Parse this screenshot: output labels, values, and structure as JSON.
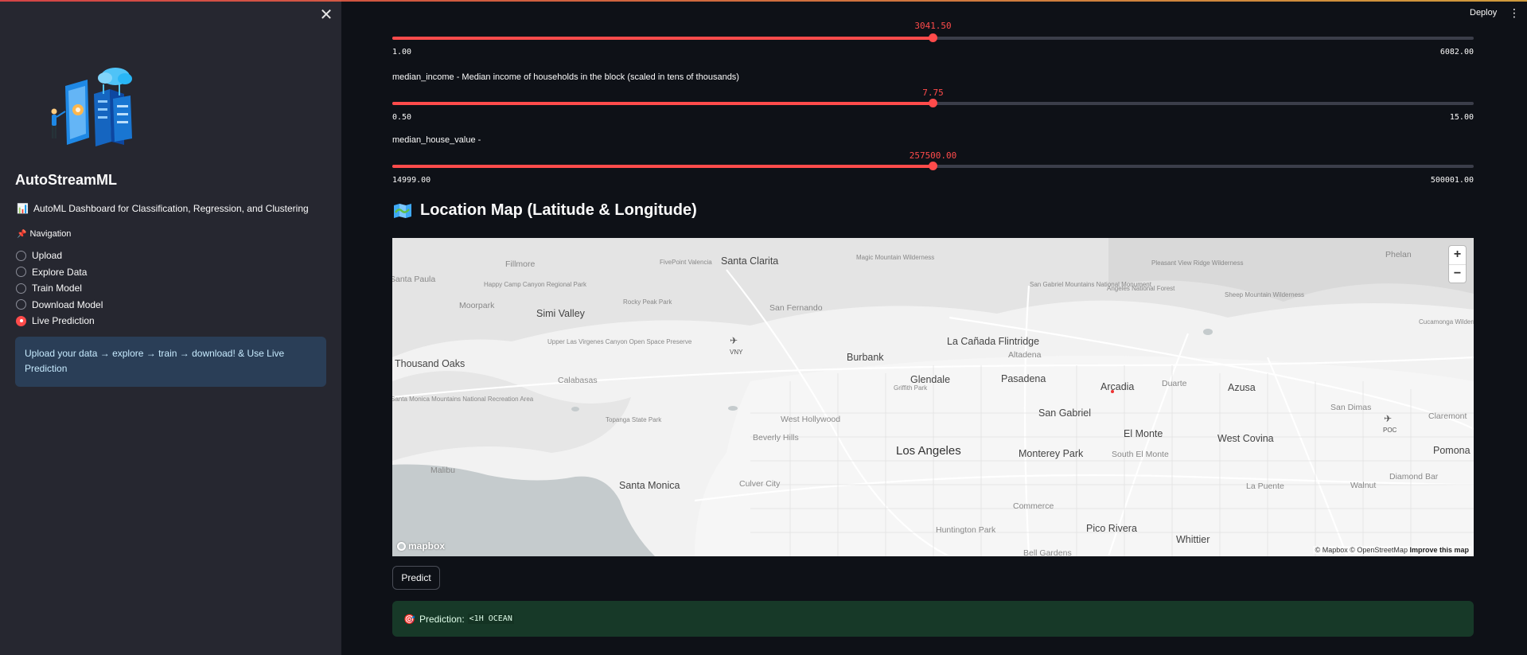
{
  "header": {
    "deploy_label": "Deploy",
    "menu_icon": "kebab-menu-icon"
  },
  "sidebar": {
    "close_icon": "close-icon",
    "title": "AutoStreamML",
    "description_icon": "bar-chart-icon",
    "description": "AutoML Dashboard for Classification, Regression, and Clustering",
    "nav_icon": "pushpin-icon",
    "nav_label": "Navigation",
    "nav_items": [
      {
        "label": "Upload",
        "selected": false
      },
      {
        "label": "Explore Data",
        "selected": false
      },
      {
        "label": "Train Model",
        "selected": false
      },
      {
        "label": "Download Model",
        "selected": false
      },
      {
        "label": "Live Prediction",
        "selected": true
      }
    ],
    "info": "Upload your data → explore → train → download! & Use Live Prediction"
  },
  "sliders": [
    {
      "label": "",
      "value": "3041.50",
      "fraction": 0.5,
      "min": "1.00",
      "max": "6082.00"
    },
    {
      "label": "median_income - Median income of households in the block (scaled in tens of thousands)",
      "value": "7.75",
      "fraction": 0.5,
      "min": "0.50",
      "max": "15.00"
    },
    {
      "label": "median_house_value -",
      "value": "257500.00",
      "fraction": 0.5,
      "min": "14999.00",
      "max": "500001.00"
    }
  ],
  "map": {
    "heading_icon": "map-icon",
    "heading": "Location Map (Latitude & Longitude)",
    "zoom_in": "+",
    "zoom_out": "−",
    "logo": "mapbox",
    "attribution": "© Mapbox © OpenStreetMap",
    "improve": "Improve this map",
    "places": {
      "santa_clarita": "Santa Clarita",
      "simi_valley": "Simi Valley",
      "thousand_oaks": "Thousand Oaks",
      "burbank": "Burbank",
      "la_canada": "La Cañada Flintridge",
      "glendale": "Glendale",
      "pasadena": "Pasadena",
      "arcadia": "Arcadia",
      "azusa": "Azusa",
      "san_gabriel": "San Gabriel",
      "el_monte": "El Monte",
      "west_covina": "West Covina",
      "los_angeles": "Los Angeles",
      "monterey_park": "Monterey Park",
      "santa_monica": "Santa Monica",
      "pico_rivera": "Pico Rivera",
      "whittier": "Whittier",
      "pomona": "Pomona",
      "san_fernando": "San Fernando",
      "west_hollywood": "West Hollywood",
      "beverly_hills": "Beverly Hills",
      "culver_city": "Culver City",
      "calabasas": "Calabasas",
      "malibu": "Malibu",
      "moorpark": "Moorpark",
      "fillmore": "Fillmore",
      "la_paula": "Santa Paula",
      "south_el_monte": "South El Monte",
      "commerce": "Commerce",
      "huntington_park": "Huntington Park",
      "bell_gardens": "Bell Gardens",
      "altadena": "Altadena",
      "duarte": "Duarte",
      "san_dimas": "San Dimas",
      "claremont": "Claremont",
      "la_puente": "La Puente",
      "walnut": "Walnut",
      "diamond_bar": "Diamond Bar",
      "phelan": "Phelan",
      "vny": "VNY",
      "poc": "POC",
      "griffith": "Griffith Park",
      "topanga": "Topanga State Park",
      "rocky_peak": "Rocky Peak Park",
      "happy_camp": "Happy Camp Canyon Regional Park",
      "upper_las_virgenes": "Upper Las Virgenes Canyon Open Space Preserve",
      "santa_monica_mtns": "Santa Monica Mountains National Recreation Area",
      "fivepoint": "FivePoint Valencia",
      "magic_mtn": "Magic Mountain Wilderness",
      "san_gabriel_mtns": "San Gabriel Mountains National Monument",
      "angeles": "Angeles National Forest",
      "sheep_mtn": "Sheep Mountain Wilderness",
      "pleasant_view": "Pleasant View Ridge Wilderness",
      "cucamonga": "Cucamonga Wilderness"
    }
  },
  "predict": {
    "button": "Predict",
    "icon": "target-icon",
    "label": "Prediction:",
    "value": "<1H OCEAN"
  }
}
